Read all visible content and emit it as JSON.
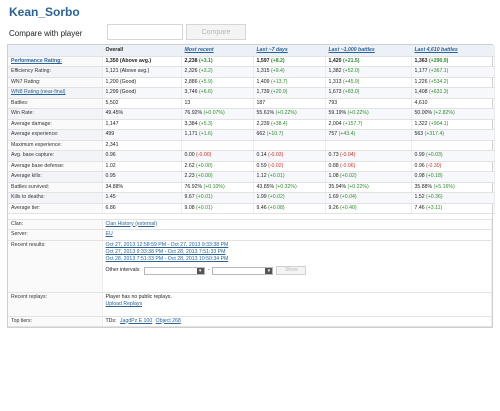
{
  "player": {
    "name": "Kean_Sorbo"
  },
  "compare": {
    "label": "Compare with player",
    "button": "Compare"
  },
  "table": {
    "headers": [
      {
        "label": "",
        "link": false
      },
      {
        "label": "Overall",
        "link": false
      },
      {
        "label": "Most recent",
        "link": true
      },
      {
        "label": "Last ~7 days",
        "link": true
      },
      {
        "label": "Last ~1,000 battles",
        "link": true
      },
      {
        "label": "Last 4,610 battles",
        "link": true
      }
    ],
    "rows": [
      {
        "label": "Performance Rating:",
        "link": true,
        "bold": true,
        "cells": [
          [
            "1,350 (Above avg.)",
            ""
          ],
          [
            "2,238 ",
            "(+3.1)"
          ],
          [
            "1,597 ",
            "(+8.2)"
          ],
          [
            "1,420 ",
            "(+21.5)"
          ],
          [
            "1,363 ",
            "(+290.9)"
          ]
        ],
        "signs": [
          "",
          "pos",
          "pos",
          "pos",
          "pos"
        ],
        "boldCells": true
      },
      {
        "label": "Efficiency Rating:",
        "link": false,
        "cells": [
          [
            "1,121 (Above avg.)",
            ""
          ],
          [
            "2,326 ",
            "(+3.2)"
          ],
          [
            "1,315 ",
            "(+9.4)"
          ],
          [
            "1,382 ",
            "(+52.0)"
          ],
          [
            "1,177 ",
            "(+367.1)"
          ]
        ],
        "signs": [
          "",
          "pos",
          "pos",
          "pos",
          "pos"
        ]
      },
      {
        "label": "WN7 Rating:",
        "link": false,
        "cells": [
          [
            "1,200 (Good)",
            ""
          ],
          [
            "2,886 ",
            "(+5.9)"
          ],
          [
            "1,409 ",
            "(+13.7)"
          ],
          [
            "1,313 ",
            "(+45.9)"
          ],
          [
            "1,226 ",
            "(+534.2)"
          ]
        ],
        "signs": [
          "",
          "pos",
          "pos",
          "pos",
          "pos"
        ]
      },
      {
        "label": "WN8 Rating (near-final)",
        "link": true,
        "cells": [
          [
            "1,299 (Good)",
            ""
          ],
          [
            "3,746 ",
            "(+6.6)"
          ],
          [
            "1,739 ",
            "(+20.9)"
          ],
          [
            "1,673 ",
            "(+83.0)"
          ],
          [
            "1,408 ",
            "(+631.3)"
          ]
        ],
        "signs": [
          "",
          "pos",
          "pos",
          "pos",
          "pos"
        ]
      },
      {
        "label": "Battles:",
        "link": false,
        "cells": [
          [
            "5,502",
            ""
          ],
          [
            "13",
            ""
          ],
          [
            "187",
            ""
          ],
          [
            "793",
            ""
          ],
          [
            "4,610",
            ""
          ]
        ],
        "signs": [
          "",
          "",
          "",
          "",
          ""
        ]
      },
      {
        "label": "Win Rate:",
        "link": false,
        "cells": [
          [
            "49.45%",
            ""
          ],
          [
            "76.92% ",
            "(+0.07%)"
          ],
          [
            "55.61% ",
            "(+0.22%)"
          ],
          [
            "59.19% ",
            "(+0.22%)"
          ],
          [
            "50.00% ",
            "(+2.82%)"
          ]
        ],
        "signs": [
          "",
          "pos",
          "pos",
          "pos",
          "pos"
        ]
      },
      {
        "label": "Average damage:",
        "link": false,
        "cells": [
          [
            "1,147",
            ""
          ],
          [
            "3,384 ",
            "(+5.3)"
          ],
          [
            "2,239 ",
            "(+38.4)"
          ],
          [
            "2,004 ",
            "(+157.7)"
          ],
          [
            "1,322 ",
            "(+904.1)"
          ]
        ],
        "signs": [
          "",
          "pos",
          "pos",
          "pos",
          "pos"
        ]
      },
      {
        "label": "Average experience:",
        "link": false,
        "cells": [
          [
            "499",
            ""
          ],
          [
            "1,171 ",
            "(+1.6)"
          ],
          [
            "662 ",
            "(+10.7)"
          ],
          [
            "757 ",
            "(+43.4)"
          ],
          [
            "563 ",
            "(+317.4)"
          ]
        ],
        "signs": [
          "",
          "pos",
          "pos",
          "pos",
          "pos"
        ]
      },
      {
        "label": "Maximum experience:",
        "link": false,
        "cells": [
          [
            "2,341",
            ""
          ],
          [
            "",
            ""
          ],
          [
            "",
            ""
          ],
          [
            "",
            ""
          ],
          [
            "",
            ""
          ]
        ],
        "signs": [
          "",
          "",
          "",
          "",
          ""
        ]
      },
      {
        "label": "Avg. base capture:",
        "link": false,
        "cells": [
          [
            "0.96",
            ""
          ],
          [
            "0.00 ",
            "(-0.00)"
          ],
          [
            "0.14 ",
            "(-0.03)"
          ],
          [
            "0.73 ",
            "(-0.04)"
          ],
          [
            "0.99 ",
            "(+0.03)"
          ]
        ],
        "signs": [
          "",
          "neg",
          "neg",
          "neg",
          "pos"
        ]
      },
      {
        "label": "Average base defense:",
        "link": false,
        "cells": [
          [
            "1.02",
            ""
          ],
          [
            "2.62 ",
            "(+0.00)"
          ],
          [
            "0.59 ",
            "(-0.02)"
          ],
          [
            "0.88 ",
            "(-0.06)"
          ],
          [
            "0.96 ",
            "(-0.30)"
          ]
        ],
        "signs": [
          "",
          "pos",
          "neg",
          "neg",
          "neg"
        ]
      },
      {
        "label": "Average kills:",
        "link": false,
        "cells": [
          [
            "0.95",
            ""
          ],
          [
            "2.23 ",
            "(+0.00)"
          ],
          [
            "1.12 ",
            "(+0.01)"
          ],
          [
            "1.08 ",
            "(+0.02)"
          ],
          [
            "0.98 ",
            "(+0.18)"
          ]
        ],
        "signs": [
          "",
          "pos",
          "pos",
          "pos",
          "pos"
        ]
      },
      {
        "label": "Battles survived:",
        "link": false,
        "cells": [
          [
            "34.88%",
            ""
          ],
          [
            "76.92% ",
            "(+0.10%)"
          ],
          [
            "43.85% ",
            "(+0.32%)"
          ],
          [
            "35.94% ",
            "(+0.22%)"
          ],
          [
            "35.88% ",
            "(+5.16%)"
          ]
        ],
        "signs": [
          "",
          "pos",
          "pos",
          "pos",
          "pos"
        ]
      },
      {
        "label": "Kills to deaths:",
        "link": false,
        "cells": [
          [
            "1.45",
            ""
          ],
          [
            "9.67 ",
            "(+0.01)"
          ],
          [
            "1.99 ",
            "(+0.02)"
          ],
          [
            "1.69 ",
            "(+0.04)"
          ],
          [
            "1.52 ",
            "(+0.36)"
          ]
        ],
        "signs": [
          "",
          "pos",
          "pos",
          "pos",
          "pos"
        ]
      },
      {
        "label": "Average tier:",
        "link": false,
        "cells": [
          [
            "6.86",
            ""
          ],
          [
            "9.08 ",
            "(+0.01)"
          ],
          [
            "9.46 ",
            "(+0.08)"
          ],
          [
            "9.26 ",
            "(+0.40)"
          ],
          [
            "7.46 ",
            "(+3.11)"
          ]
        ],
        "signs": [
          "",
          "pos",
          "pos",
          "pos",
          "pos"
        ]
      }
    ]
  },
  "info": {
    "clan": {
      "label": "Clan:",
      "value": "Clan History (external)"
    },
    "server": {
      "label": "Server:",
      "value": "EU"
    },
    "recent": {
      "label": "Recent results:",
      "links": [
        "Oct 27, 2013 12:58:59 PM - Oct 27, 2013 9:33:38 PM",
        "Oct 27, 2013 9:33:38 PM - Oct 28, 2013 7:51:33 PM",
        "Oct 28, 2013 7:51:33 PM - Oct 28, 2013 10:50:34 PM"
      ],
      "other_label": "Other intervals:",
      "dash": "-",
      "show_button": "Show"
    },
    "replays": {
      "label": "Recent replays:",
      "text": "Player has no public replays.",
      "upload": "Upload Replays"
    },
    "toptiers": {
      "label": "Top tiers:",
      "prefix": "TDs:",
      "tanks": [
        "JagdPz E 100",
        "Object 268"
      ]
    }
  }
}
